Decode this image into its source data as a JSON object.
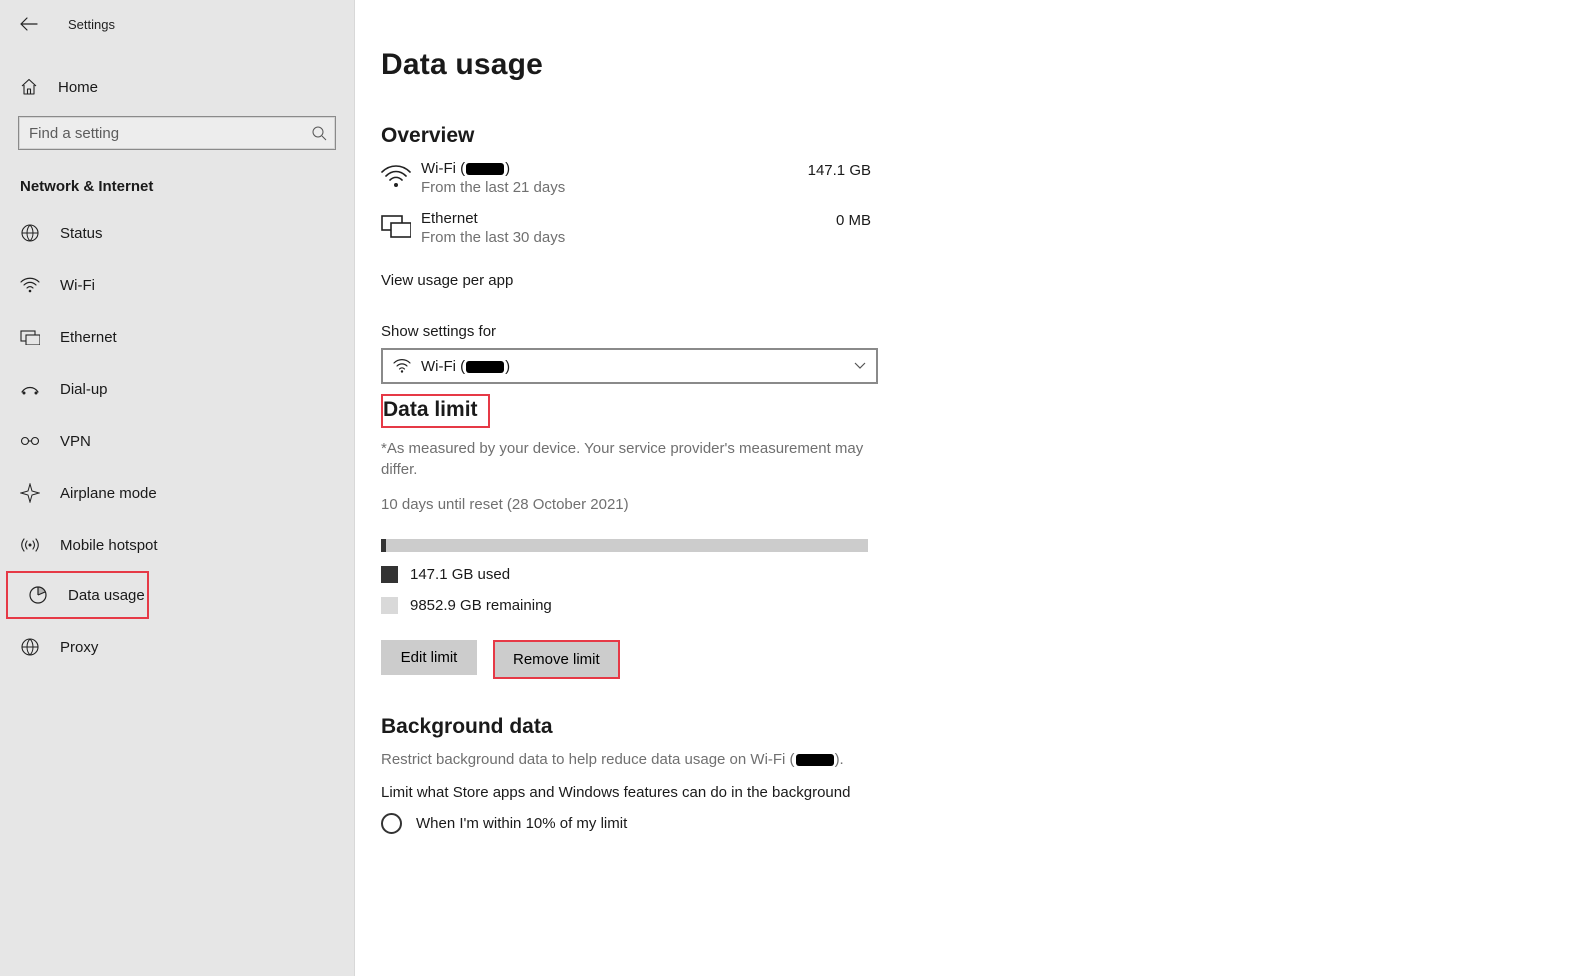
{
  "window": {
    "title": "Settings"
  },
  "sidebar": {
    "home": "Home",
    "search_placeholder": "Find a setting",
    "section": "Network & Internet",
    "items": [
      {
        "label": "Status"
      },
      {
        "label": "Wi-Fi"
      },
      {
        "label": "Ethernet"
      },
      {
        "label": "Dial-up"
      },
      {
        "label": "VPN"
      },
      {
        "label": "Airplane mode"
      },
      {
        "label": "Mobile hotspot"
      },
      {
        "label": "Data usage"
      },
      {
        "label": "Proxy"
      }
    ]
  },
  "page": {
    "title": "Data usage",
    "overview_heading": "Overview",
    "overview": [
      {
        "name_prefix": "Wi-Fi (",
        "name_suffix": ")",
        "period": "From the last 21 days",
        "value": "147.1 GB"
      },
      {
        "name_prefix": "Ethernet",
        "name_suffix": "",
        "period": "From the last 30 days",
        "value": "0 MB"
      }
    ],
    "view_usage_link": "View usage per app",
    "show_settings_label": "Show settings for",
    "dropdown_prefix": "Wi-Fi (",
    "dropdown_suffix": ")",
    "data_limit": {
      "heading": "Data limit",
      "note": "*As measured by your device. Your service provider's measurement may differ.",
      "reset_line": "10 days until reset (28 October 2021)",
      "used_label": "147.1 GB used",
      "remaining_label": "9852.9 GB remaining",
      "edit_btn": "Edit limit",
      "remove_btn": "Remove limit"
    },
    "background": {
      "heading": "Background data",
      "note_prefix": "Restrict background data to help reduce data usage on Wi-Fi (",
      "note_suffix": ").",
      "limit_line": "Limit what Store apps and Windows features can do in the background",
      "radio_option": "When I'm within 10% of my limit"
    }
  }
}
